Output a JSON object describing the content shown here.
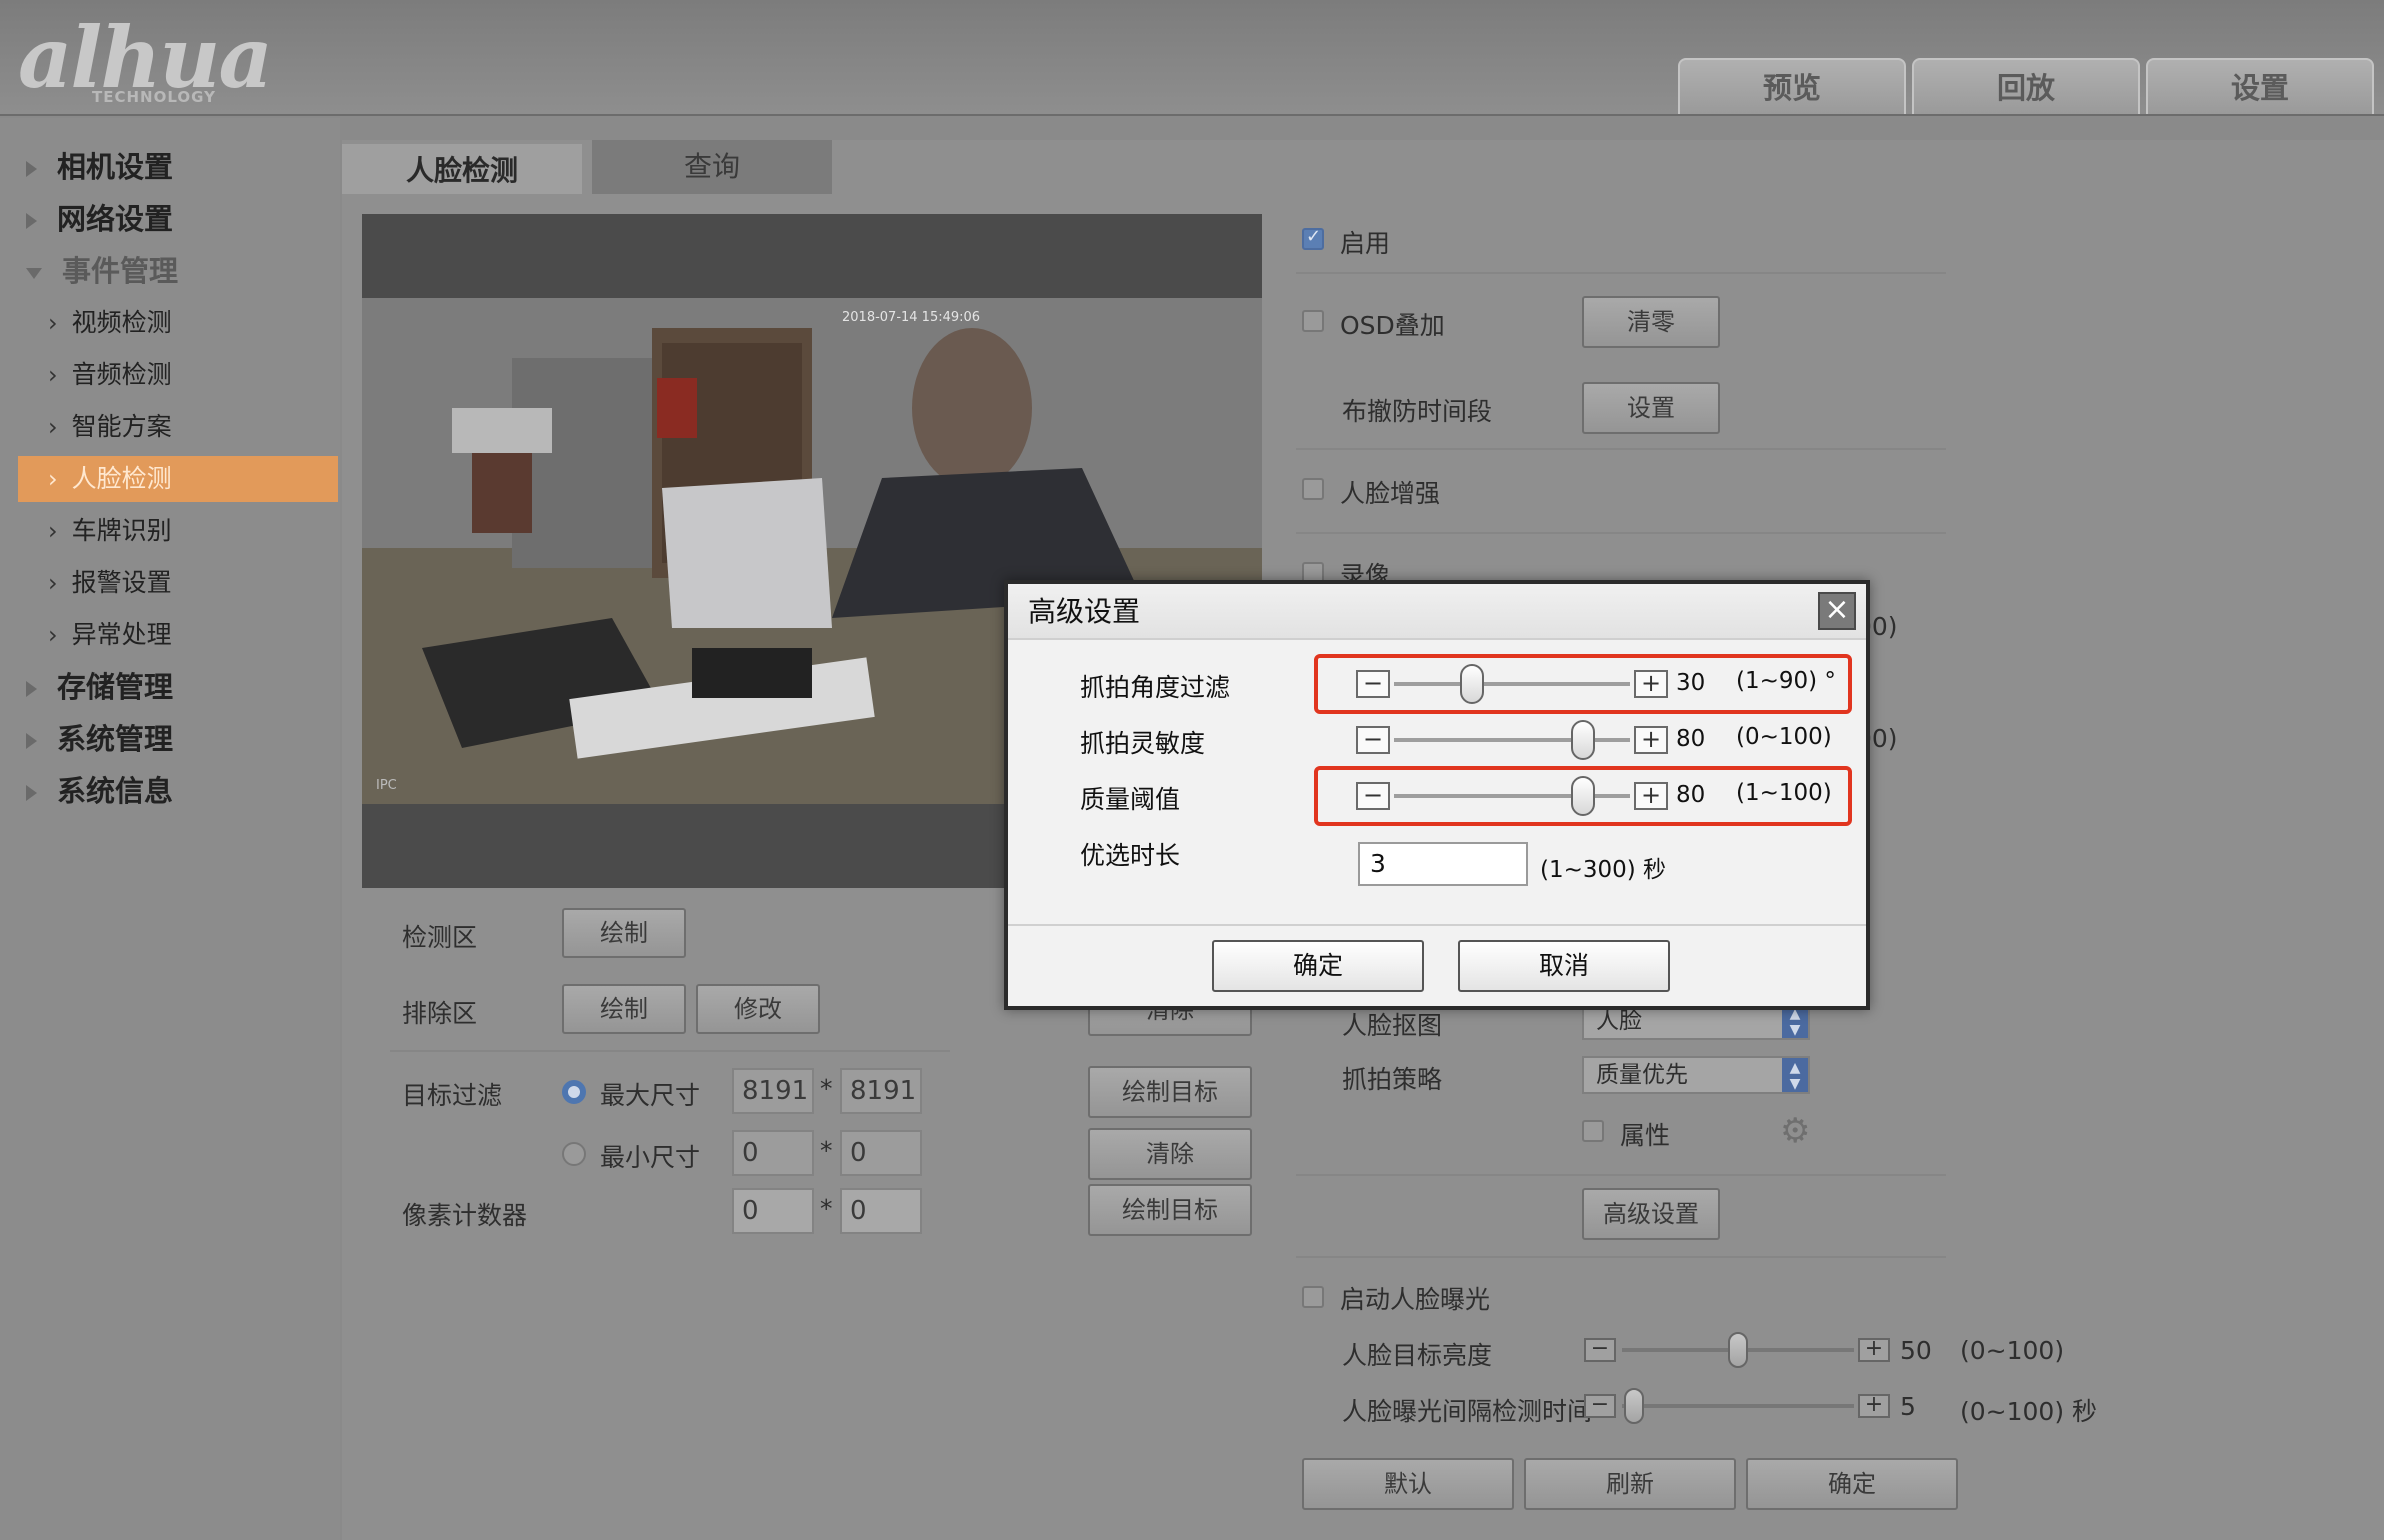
{
  "brand": {
    "logo": "alhua",
    "sub": "TECHNOLOGY"
  },
  "top_tabs": [
    {
      "label": "预览"
    },
    {
      "label": "回放"
    },
    {
      "label": "设置"
    }
  ],
  "sidebar": {
    "items": [
      {
        "label": "相机设置"
      },
      {
        "label": "网络设置"
      },
      {
        "label": "事件管理"
      },
      {
        "label": "视频检测"
      },
      {
        "label": "音频检测"
      },
      {
        "label": "智能方案"
      },
      {
        "label": "人脸检测"
      },
      {
        "label": "车牌识别"
      },
      {
        "label": "报警设置"
      },
      {
        "label": "异常处理"
      },
      {
        "label": "存储管理"
      },
      {
        "label": "系统管理"
      },
      {
        "label": "系统信息"
      }
    ],
    "selected": "人脸检测"
  },
  "tabs": [
    {
      "label": "人脸检测"
    },
    {
      "label": "查询"
    }
  ],
  "video": {
    "timestamp": "2018-07-14 15:49:06",
    "corner": "IPC"
  },
  "left_form": {
    "detect_area": "检测区",
    "draw": "绘制",
    "exclude_area": "排除区",
    "modify": "修改",
    "target_filter": "目标过滤",
    "max_size": "最大尺寸",
    "max_w": "8191",
    "max_h": "8191",
    "min_size": "最小尺寸",
    "min_w": "0",
    "min_h": "0",
    "pixel_counter": "像素计数器",
    "px_w": "0",
    "px_h": "0",
    "times": "*"
  },
  "mid_buttons": {
    "clear1": "清除",
    "draw_target1": "绘制目标",
    "clear2": "清除",
    "draw_target2": "绘制目标"
  },
  "right_form": {
    "enable": "启用",
    "osd": "OSD叠加",
    "reset": "清零",
    "schedule": "布撤防时间段",
    "set": "设置",
    "face_enhance": "人脸增强",
    "record": "录像",
    "face_crop": "人脸抠图",
    "face_crop_value": "人脸",
    "strategy": "抓拍策略",
    "strategy_value": "质量优先",
    "attribute": "属性",
    "advanced": "高级设置",
    "face_exposure": "启动人脸曝光",
    "brightness_label": "人脸目标亮度",
    "brightness_value": "50",
    "brightness_range": "(0~100)",
    "brightness_level": 0.5,
    "interval_label": "人脸曝光间隔检测时间",
    "interval_value": "5",
    "interval_range": "(0~100) 秒",
    "interval_level": 0.05,
    "hidden_range1": "00)",
    "hidden_range2": "00)",
    "default": "默认",
    "refresh": "刷新",
    "confirm": "确定"
  },
  "dialog": {
    "title": "高级设置",
    "rows": [
      {
        "label": "抓拍角度过滤",
        "value": "30",
        "range": "(1~90) °",
        "level": 0.33
      },
      {
        "label": "抓拍灵敏度",
        "value": "80",
        "range": "(0~100)",
        "level": 0.8
      },
      {
        "label": "质量阈值",
        "value": "80",
        "range": "(1~100)",
        "level": 0.8
      }
    ],
    "pref_label": "优选时长",
    "pref_value": "3",
    "pref_range": "(1~300) 秒",
    "ok": "确定",
    "cancel": "取消"
  }
}
